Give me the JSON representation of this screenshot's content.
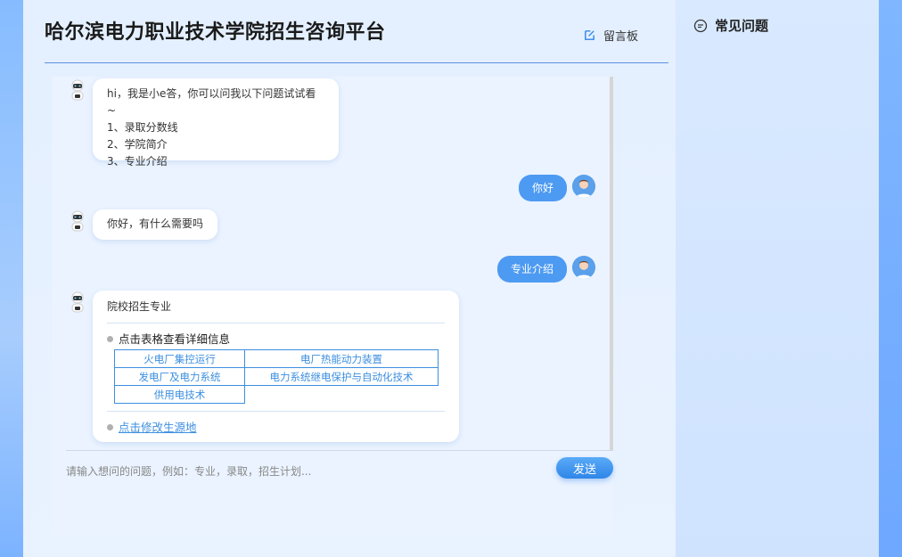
{
  "header": {
    "title": "哈尔滨电力职业技术学院招生咨询平台",
    "message_board": "留言板"
  },
  "chat": {
    "greeting": {
      "intro": "hi，我是小e答，你可以问我以下问题试试看~",
      "options": [
        "1、录取分数线",
        "2、学院简介",
        "3、专业介绍"
      ]
    },
    "user_msg_1": "你好",
    "bot_reply_1": "你好，有什么需要吗",
    "user_msg_2": "专业介绍",
    "majors_reply": {
      "title": "院校招生专业",
      "tip": "点击表格查看详细信息",
      "majors": [
        [
          "火电厂集控运行",
          "电厂热能动力装置"
        ],
        [
          "发电厂及电力系统",
          "电力系统继电保护与自动化技术"
        ],
        [
          "供用电技术"
        ]
      ],
      "modify_link": "点击修改生源地"
    }
  },
  "input": {
    "placeholder": "请输入想问的问题，例如：专业，录取，招生计划...",
    "send_label": "发送"
  },
  "faq": {
    "title": "常见问题"
  },
  "colors": {
    "accent": "#4d9af2",
    "link": "#3d8fe0",
    "title": "#1a1a1a"
  },
  "icons": {
    "message_board": "edit-icon",
    "faq": "chat-bubble-icon",
    "bot": "robot-avatar",
    "user": "user-avatar"
  }
}
